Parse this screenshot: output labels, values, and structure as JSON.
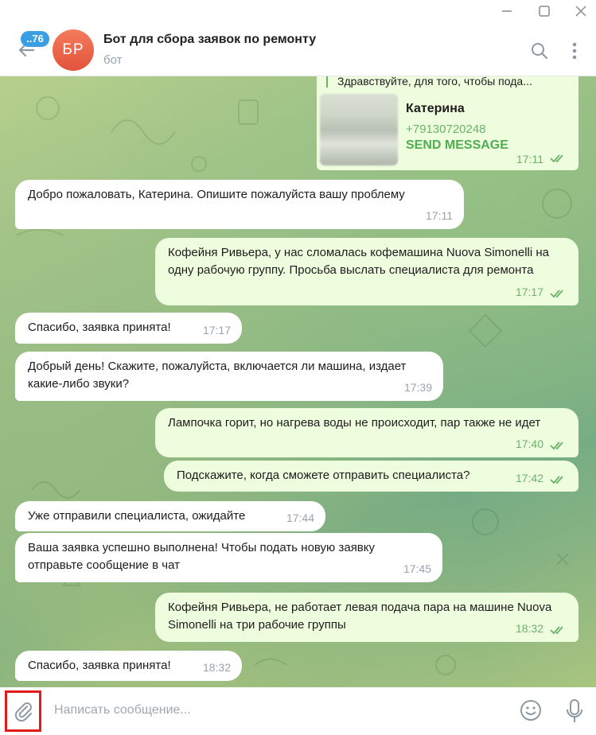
{
  "header": {
    "unread_badge": "..76",
    "avatar_initials": "БР",
    "title": "Бот для сбора заявок по ремонту",
    "subtitle": "бот"
  },
  "icons": {
    "back": "arrow-left-icon",
    "search": "search-icon",
    "more": "more-vertical-icon",
    "attach": "paperclip-icon",
    "emoji": "emoji-icon",
    "mic": "microphone-icon",
    "read": "double-check-icon"
  },
  "colors": {
    "accent": "#3a9ee2",
    "outgoing_bubble": "#effddf",
    "incoming_bubble": "#ffffff",
    "read_check": "#6bb36a",
    "avatar": "#e96a4f",
    "highlight_box": "#e31b1b"
  },
  "contact_message": {
    "quote": "Здравствуйте, для того, чтобы пода...",
    "name": "Катерина",
    "phone": "+79130720248",
    "action": "SEND MESSAGE",
    "time": "17:11"
  },
  "messages": [
    {
      "dir": "in",
      "text": "Добро пожаловать, Катерина. Опишите пожалуйста вашу проблему",
      "time": "17:11"
    },
    {
      "dir": "out",
      "text": "Кофейня Ривьера, у нас сломалась кофемашина Nuova Simonelli на одну рабочую группу. Просьба выслать специалиста для ремонта",
      "time": "17:17"
    },
    {
      "dir": "in",
      "text": "Спасибо, заявка принята!",
      "time": "17:17"
    },
    {
      "dir": "in",
      "text": "Добрый день! Скажите, пожалуйста, включается ли машина, издает какие-либо звуки?",
      "time": "17:39"
    },
    {
      "dir": "out",
      "text": "Лампочка горит, но нагрева воды не происходит, пар также не идет",
      "time": "17:40"
    },
    {
      "dir": "out",
      "text": "Подскажите, когда сможете отправить специалиста?",
      "time": "17:42"
    },
    {
      "dir": "in",
      "text": "Уже отправили специалиста, ожидайте",
      "time": "17:44"
    },
    {
      "dir": "in",
      "text": "Ваша заявка успешно выполнена! Чтобы подать новую заявку отправьте сообщение в чат",
      "time": "17:45"
    },
    {
      "dir": "out",
      "text": "Кофейня Ривьера, не работает левая подача пара на машине Nuova Simonelli на три рабочие группы",
      "time": "18:32"
    },
    {
      "dir": "in",
      "text": "Спасибо, заявка принята!",
      "time": "18:32"
    }
  ],
  "composer": {
    "placeholder": "Написать сообщение..."
  }
}
